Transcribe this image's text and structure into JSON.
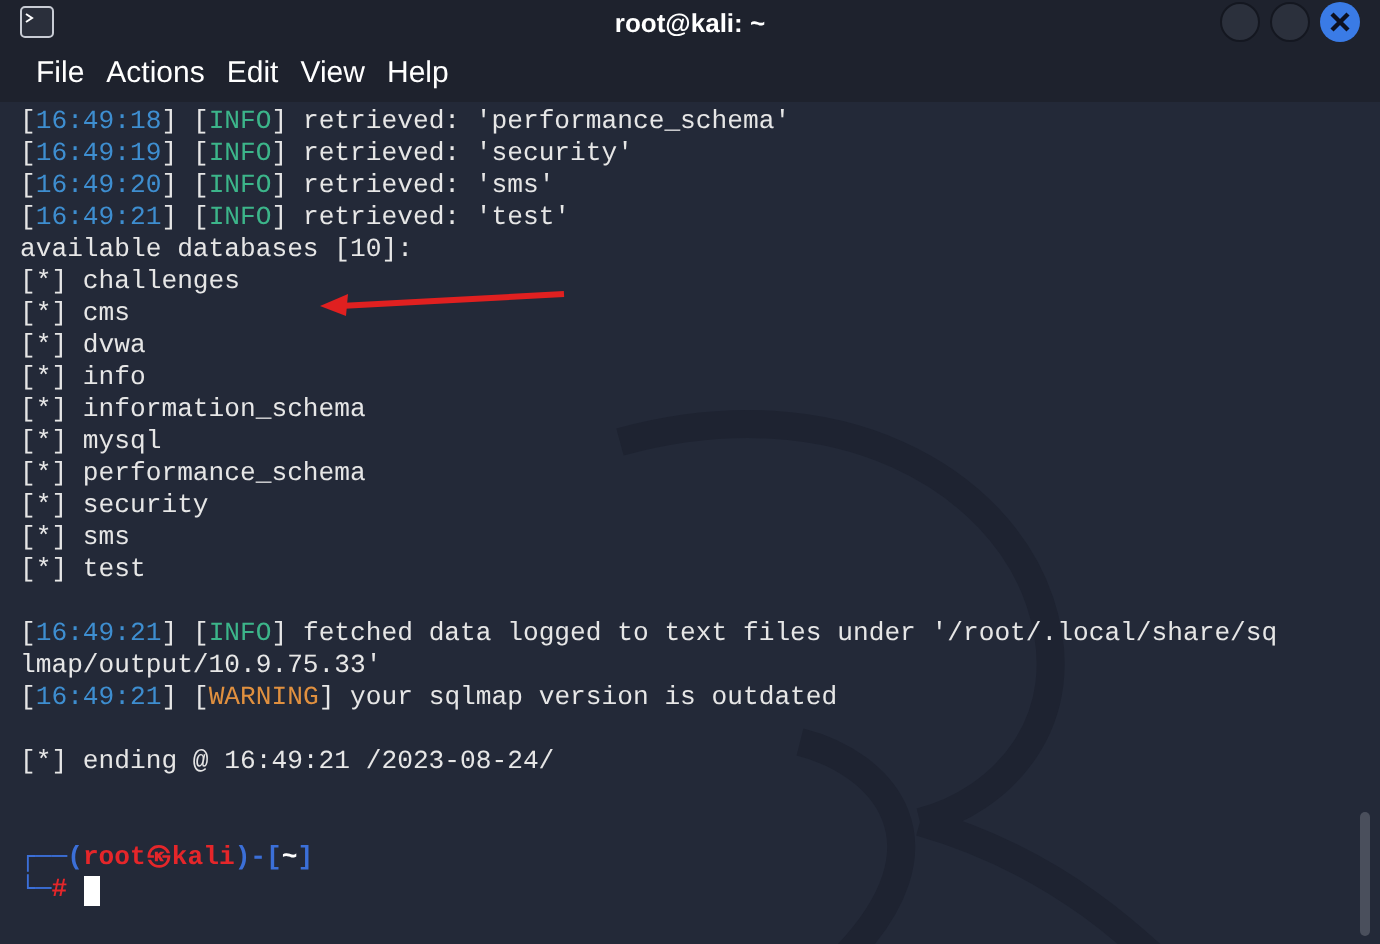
{
  "window": {
    "title": "root@kali: ~"
  },
  "menu": [
    "File",
    "Actions",
    "Edit",
    "View",
    "Help"
  ],
  "lines": [
    {
      "kind": "log",
      "segments": [
        {
          "kind": "plain",
          "text": "["
        },
        {
          "kind": "time",
          "text": "16:49:18"
        },
        {
          "kind": "plain",
          "text": "] ["
        },
        {
          "kind": "info",
          "text": "INFO"
        },
        {
          "kind": "plain",
          "text": "] retrieved: 'performance_schema'"
        }
      ]
    },
    {
      "kind": "log",
      "segments": [
        {
          "kind": "plain",
          "text": "["
        },
        {
          "kind": "time",
          "text": "16:49:19"
        },
        {
          "kind": "plain",
          "text": "] ["
        },
        {
          "kind": "info",
          "text": "INFO"
        },
        {
          "kind": "plain",
          "text": "] retrieved: 'security'"
        }
      ]
    },
    {
      "kind": "log",
      "segments": [
        {
          "kind": "plain",
          "text": "["
        },
        {
          "kind": "time",
          "text": "16:49:20"
        },
        {
          "kind": "plain",
          "text": "] ["
        },
        {
          "kind": "info",
          "text": "INFO"
        },
        {
          "kind": "plain",
          "text": "] retrieved: 'sms'"
        }
      ]
    },
    {
      "kind": "log",
      "segments": [
        {
          "kind": "plain",
          "text": "["
        },
        {
          "kind": "time",
          "text": "16:49:21"
        },
        {
          "kind": "plain",
          "text": "] ["
        },
        {
          "kind": "info",
          "text": "INFO"
        },
        {
          "kind": "plain",
          "text": "] retrieved: 'test'"
        }
      ]
    },
    {
      "kind": "plain",
      "text": "available databases [10]:"
    },
    {
      "kind": "plain",
      "text": "[*] challenges"
    },
    {
      "kind": "plain",
      "text": "[*] cms"
    },
    {
      "kind": "plain",
      "text": "[*] dvwa"
    },
    {
      "kind": "plain",
      "text": "[*] info"
    },
    {
      "kind": "plain",
      "text": "[*] information_schema"
    },
    {
      "kind": "plain",
      "text": "[*] mysql"
    },
    {
      "kind": "plain",
      "text": "[*] performance_schema"
    },
    {
      "kind": "plain",
      "text": "[*] security"
    },
    {
      "kind": "plain",
      "text": "[*] sms"
    },
    {
      "kind": "plain",
      "text": "[*] test"
    },
    {
      "kind": "blank"
    },
    {
      "kind": "log",
      "segments": [
        {
          "kind": "plain",
          "text": "["
        },
        {
          "kind": "time",
          "text": "16:49:21"
        },
        {
          "kind": "plain",
          "text": "] ["
        },
        {
          "kind": "info",
          "text": "INFO"
        },
        {
          "kind": "plain",
          "text": "] fetched data logged to text files under '/root/.local/share/sqlmap/output/10.9.75.33'"
        }
      ]
    },
    {
      "kind": "log",
      "segments": [
        {
          "kind": "plain",
          "text": "["
        },
        {
          "kind": "time",
          "text": "16:49:21"
        },
        {
          "kind": "plain",
          "text": "] ["
        },
        {
          "kind": "warning",
          "text": "WARNING"
        },
        {
          "kind": "plain",
          "text": "] your sqlmap version is outdated"
        }
      ]
    },
    {
      "kind": "blank"
    },
    {
      "kind": "plain",
      "text": "[*] ending @ 16:49:21 /2023-08-24/"
    },
    {
      "kind": "blank"
    },
    {
      "kind": "blank"
    }
  ],
  "prompt": {
    "open": "┌──(",
    "user": "root",
    "at": "㉿",
    "host": "kali",
    "mid": ")-[",
    "dir": "~",
    "close": "]",
    "corner": "└─",
    "symbol": "#"
  }
}
